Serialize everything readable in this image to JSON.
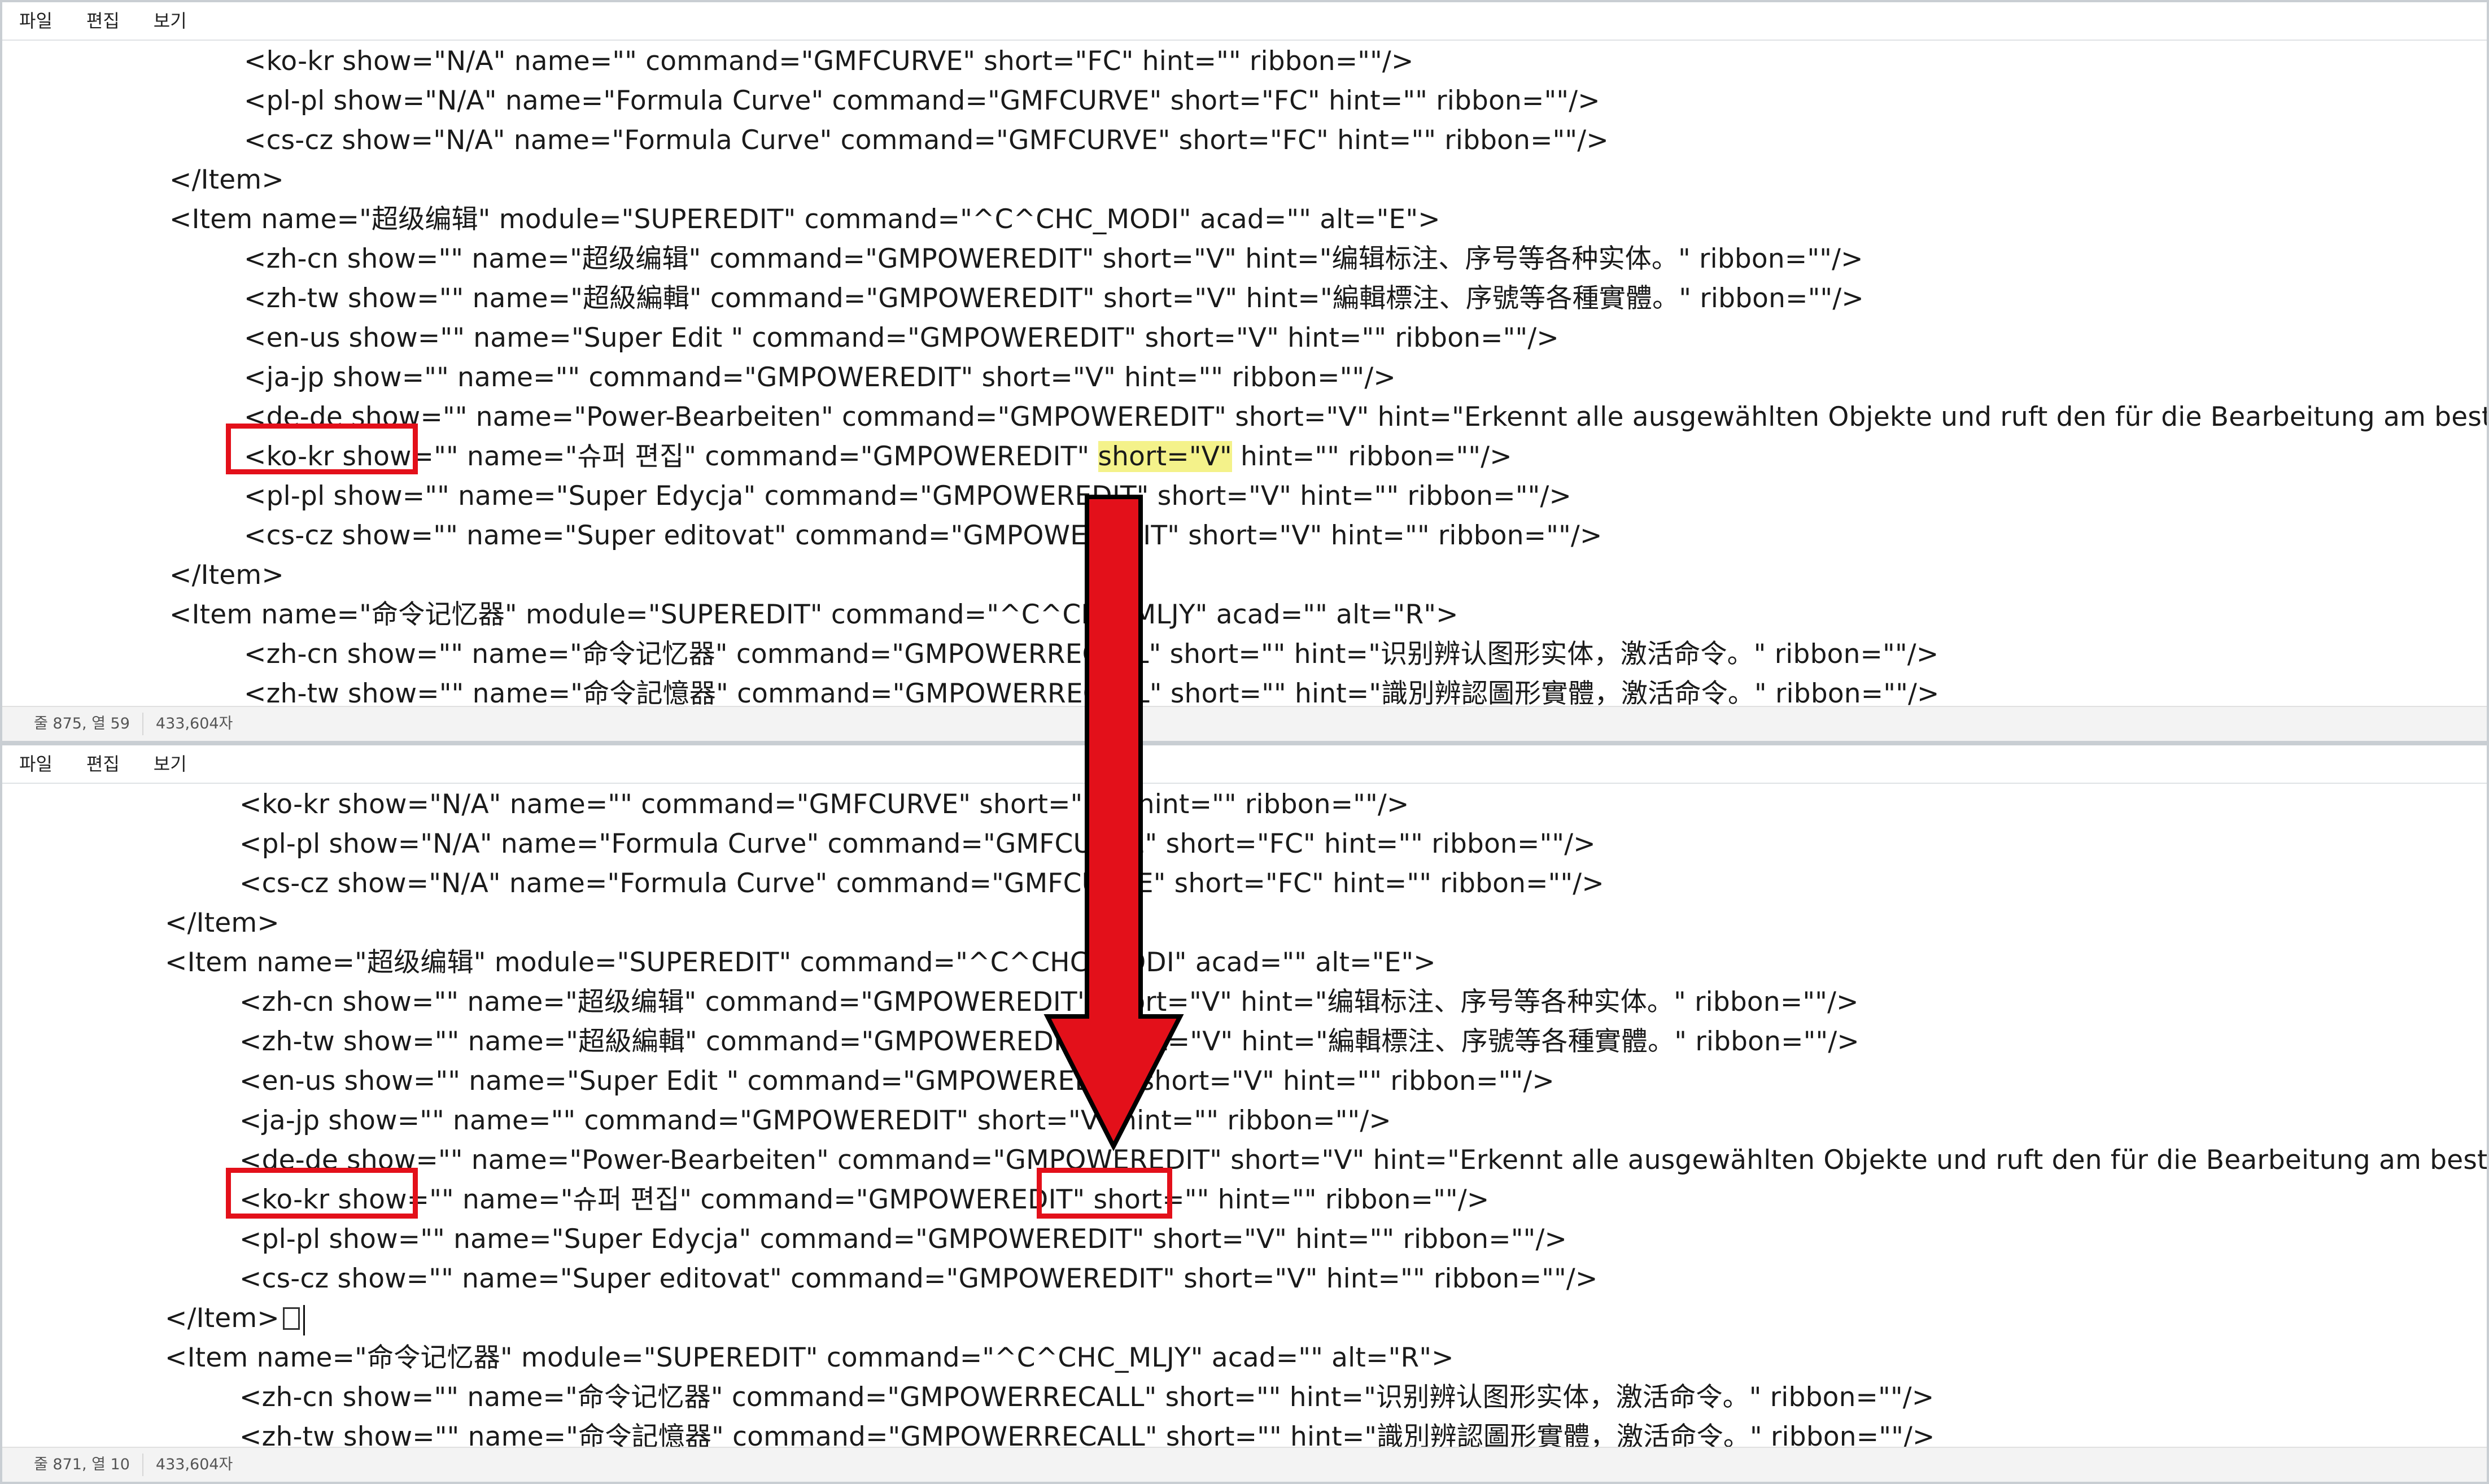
{
  "menu": {
    "file": "파일",
    "edit": "편집",
    "view": "보기"
  },
  "top_pane": {
    "lines": [
      "<ko-kr show=\"N/A\" name=\"\" command=\"GMFCURVE\" short=\"FC\" hint=\"\" ribbon=\"\"/>",
      "<pl-pl show=\"N/A\" name=\"Formula Curve\" command=\"GMFCURVE\" short=\"FC\" hint=\"\" ribbon=\"\"/>",
      "<cs-cz show=\"N/A\" name=\"Formula Curve\" command=\"GMFCURVE\" short=\"FC\" hint=\"\" ribbon=\"\"/>",
      "</Item>",
      "<Item name=\"超级编辑\" module=\"SUPEREDIT\" command=\"^C^CHC_MODI\" acad=\"\" alt=\"E\">",
      "<zh-cn show=\"\" name=\"超级编辑\" command=\"GMPOWEREDIT\" short=\"V\" hint=\"编辑标注、序号等各种实体。\" ribbon=\"\"/>",
      "<zh-tw show=\"\" name=\"超級編輯\" command=\"GMPOWEREDIT\" short=\"V\" hint=\"編輯標注、序號等各種實體。\" ribbon=\"\"/>",
      "<en-us show=\"\" name=\"Super Edit \" command=\"GMPOWEREDIT\" short=\"V\" hint=\"\" ribbon=\"\"/>",
      "<ja-jp show=\"\" name=\"\" command=\"GMPOWEREDIT\" short=\"V\" hint=\"\" ribbon=\"\"/>",
      "<de-de show=\"\" name=\"Power-Bearbeiten\" command=\"GMPOWEREDIT\" short=\"V\" hint=\"Erkennt alle ausgewählten Objekte und ruft den für die Bearbeitung am besten geeigneten",
      "<ko-kr show=\"\" name=\"슈퍼 편집\" command=\"GMPOWEREDIT\" ",
      "short=\"V\"",
      " hint=\"\" ribbon=\"\"/>",
      "<pl-pl show=\"\" name=\"Super Edycja\" command=\"GMPOWEREDIT\" short=\"V\" hint=\"\" ribbon=\"\"/>",
      "<cs-cz show=\"\" name=\"Super editovat\" command=\"GMPOWEREDIT\" short=\"V\" hint=\"\" ribbon=\"\"/>",
      "</Item>",
      "<Item name=\"命令记忆器\" module=\"SUPEREDIT\" command=\"^C^CHC_MLJY\" acad=\"\" alt=\"R\">",
      "<zh-cn show=\"\" name=\"命令记忆器\" command=\"GMPOWERRECALL\" short=\"\" hint=\"识别辨认图形实体，激活命令。\" ribbon=\"\"/>",
      "<zh-tw show=\"\" name=\"命令記憶器\" command=\"GMPOWERRECALL\" short=\"\" hint=\"識別辨認圖形實體，激活命令。\" ribbon=\"\"/>"
    ],
    "status": {
      "position": "줄 875, 열 59",
      "chars": "433,604자"
    }
  },
  "bottom_pane": {
    "lines": [
      "<ko-kr show=\"N/A\" name=\"\" command=\"GMFCURVE\" short=\"FC\" hint=\"\" ribbon=\"\"/>",
      "<pl-pl show=\"N/A\" name=\"Formula Curve\" command=\"GMFCURVE\" short=\"FC\" hint=\"\" ribbon=\"\"/>",
      "<cs-cz show=\"N/A\" name=\"Formula Curve\" command=\"GMFCURVE\" short=\"FC\" hint=\"\" ribbon=\"\"/>",
      "</Item>",
      "<Item name=\"超级编辑\" module=\"SUPEREDIT\" command=\"^C^CHC_MODI\" acad=\"\" alt=\"E\">",
      "<zh-cn show=\"\" name=\"超级编辑\" command=\"GMPOWEREDIT\" short=\"V\" hint=\"编辑标注、序号等各种实体。\" ribbon=\"\"/>",
      "<zh-tw show=\"\" name=\"超級編輯\" command=\"GMPOWEREDIT\" short=\"V\" hint=\"編輯標注、序號等各種實體。\" ribbon=\"\"/>",
      "<en-us show=\"\" name=\"Super Edit \" command=\"GMPOWEREDIT\" short=\"V\" hint=\"\" ribbon=\"\"/>",
      "<ja-jp show=\"\" name=\"\" command=\"GMPOWEREDIT\" short=\"V\" hint=\"\" ribbon=\"\"/>",
      "<de-de show=\"\" name=\"Power-Bearbeiten\" command=\"GMPOWEREDIT\" short=\"V\" hint=\"Erkennt alle ausgewählten Objekte und ruft den für die Bearbeitung am besten geeigneten",
      "<ko-kr show=\"\" name=\"슈퍼 편집\" command=\"GMPOWEREDIT\" short=\"\" hint=\"\" ribbon=\"\"/>",
      "<pl-pl show=\"\" name=\"Super Edycja\" command=\"GMPOWEREDIT\" short=\"V\" hint=\"\" ribbon=\"\"/>",
      "<cs-cz show=\"\" name=\"Super editovat\" command=\"GMPOWEREDIT\" short=\"V\" hint=\"\" ribbon=\"\"/>",
      "</Item>",
      "<Item name=\"命令记忆器\" module=\"SUPEREDIT\" command=\"^C^CHC_MLJY\" acad=\"\" alt=\"R\">",
      "<zh-cn show=\"\" name=\"命令记忆器\" command=\"GMPOWERRECALL\" short=\"\" hint=\"识别辨认图形实体，激活命令。\" ribbon=\"\"/>",
      "<zh-tw show=\"\" name=\"命令記憶器\" command=\"GMPOWERRECALL\" short=\"\" hint=\"識別辨認圖形實體，激活命令。\" ribbon=\"\"/>"
    ],
    "status": {
      "position": "줄 871, 열 10",
      "chars": "433,604자"
    }
  },
  "colors": {
    "annotation_red": "#e3101a",
    "highlight_yellow": "#f4f28a"
  }
}
